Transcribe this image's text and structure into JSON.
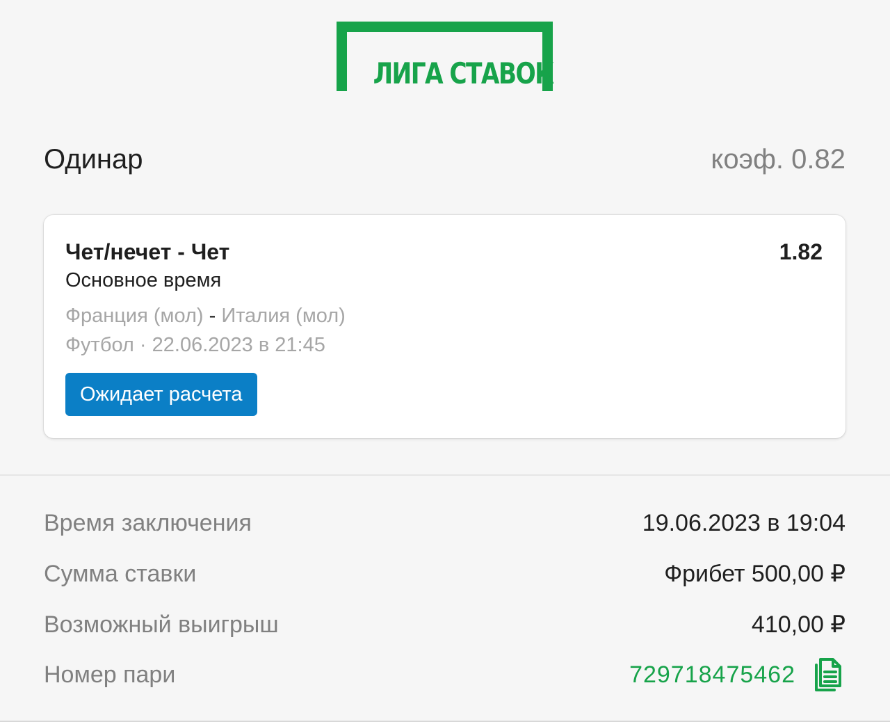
{
  "brand": {
    "logo_text": "ЛИГА СТАВОК",
    "color": "#17a34a"
  },
  "bet": {
    "type": "Одинар",
    "total_coef": "коэф. 0.82"
  },
  "event": {
    "market": "Чет/нечет - Чет",
    "odd": "1.82",
    "period": "Основное время",
    "team_home": "Франция (мол)",
    "team_separator": "-",
    "team_away": "Италия (мол)",
    "meta": "Футбол · 22.06.2023 в 21:45",
    "status": "Ожидает расчета",
    "status_color": "#0b7fc6"
  },
  "details": {
    "time_label": "Время заключения",
    "time_value": "19.06.2023 в 19:04",
    "amount_label": "Сумма ставки",
    "amount_value": "Фрибет 500,00 ₽",
    "win_label": "Возможный выигрыш",
    "win_value": "410,00  ₽",
    "number_label": "Номер пари",
    "number_value": "729718475462",
    "copy_icon": "copy-icon"
  }
}
